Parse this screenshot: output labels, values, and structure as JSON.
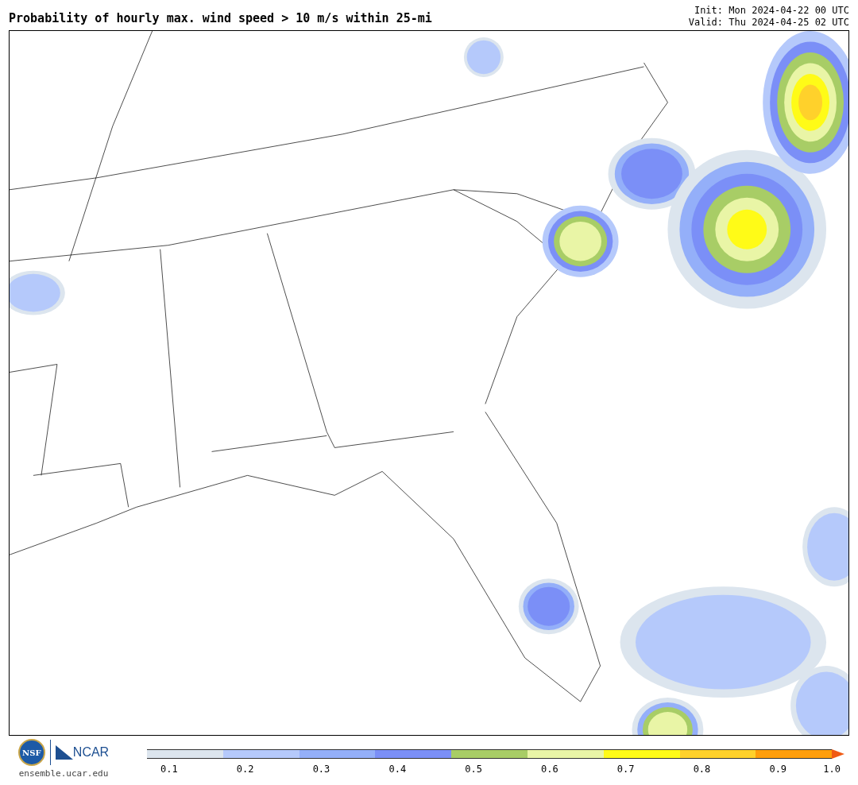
{
  "title": "Probability of hourly max. wind speed > 10 m/s within 25-mi",
  "init": "Init: Mon 2024-04-22 00 UTC",
  "valid": "Valid: Thu 2024-04-25 02 UTC",
  "logos": {
    "nsf": "NSF",
    "ncar": "NCAR",
    "url": "ensemble.ucar.edu"
  },
  "colorbar": {
    "bins": [
      {
        "color": "#dce5ee"
      },
      {
        "color": "#b5c9fb"
      },
      {
        "color": "#94aff9"
      },
      {
        "color": "#7b8ff7"
      },
      {
        "color": "#a8cd66"
      },
      {
        "color": "#e9f5a6"
      },
      {
        "color": "#fffb17"
      },
      {
        "color": "#ffd12b"
      },
      {
        "color": "#ff9e0b"
      },
      {
        "color": "#f05a14",
        "kind": "arrow"
      }
    ],
    "ticks": [
      "0.1",
      "0.2",
      "0.3",
      "0.4",
      "0.5",
      "0.6",
      "0.7",
      "0.8",
      "0.9",
      "1.0"
    ]
  }
}
